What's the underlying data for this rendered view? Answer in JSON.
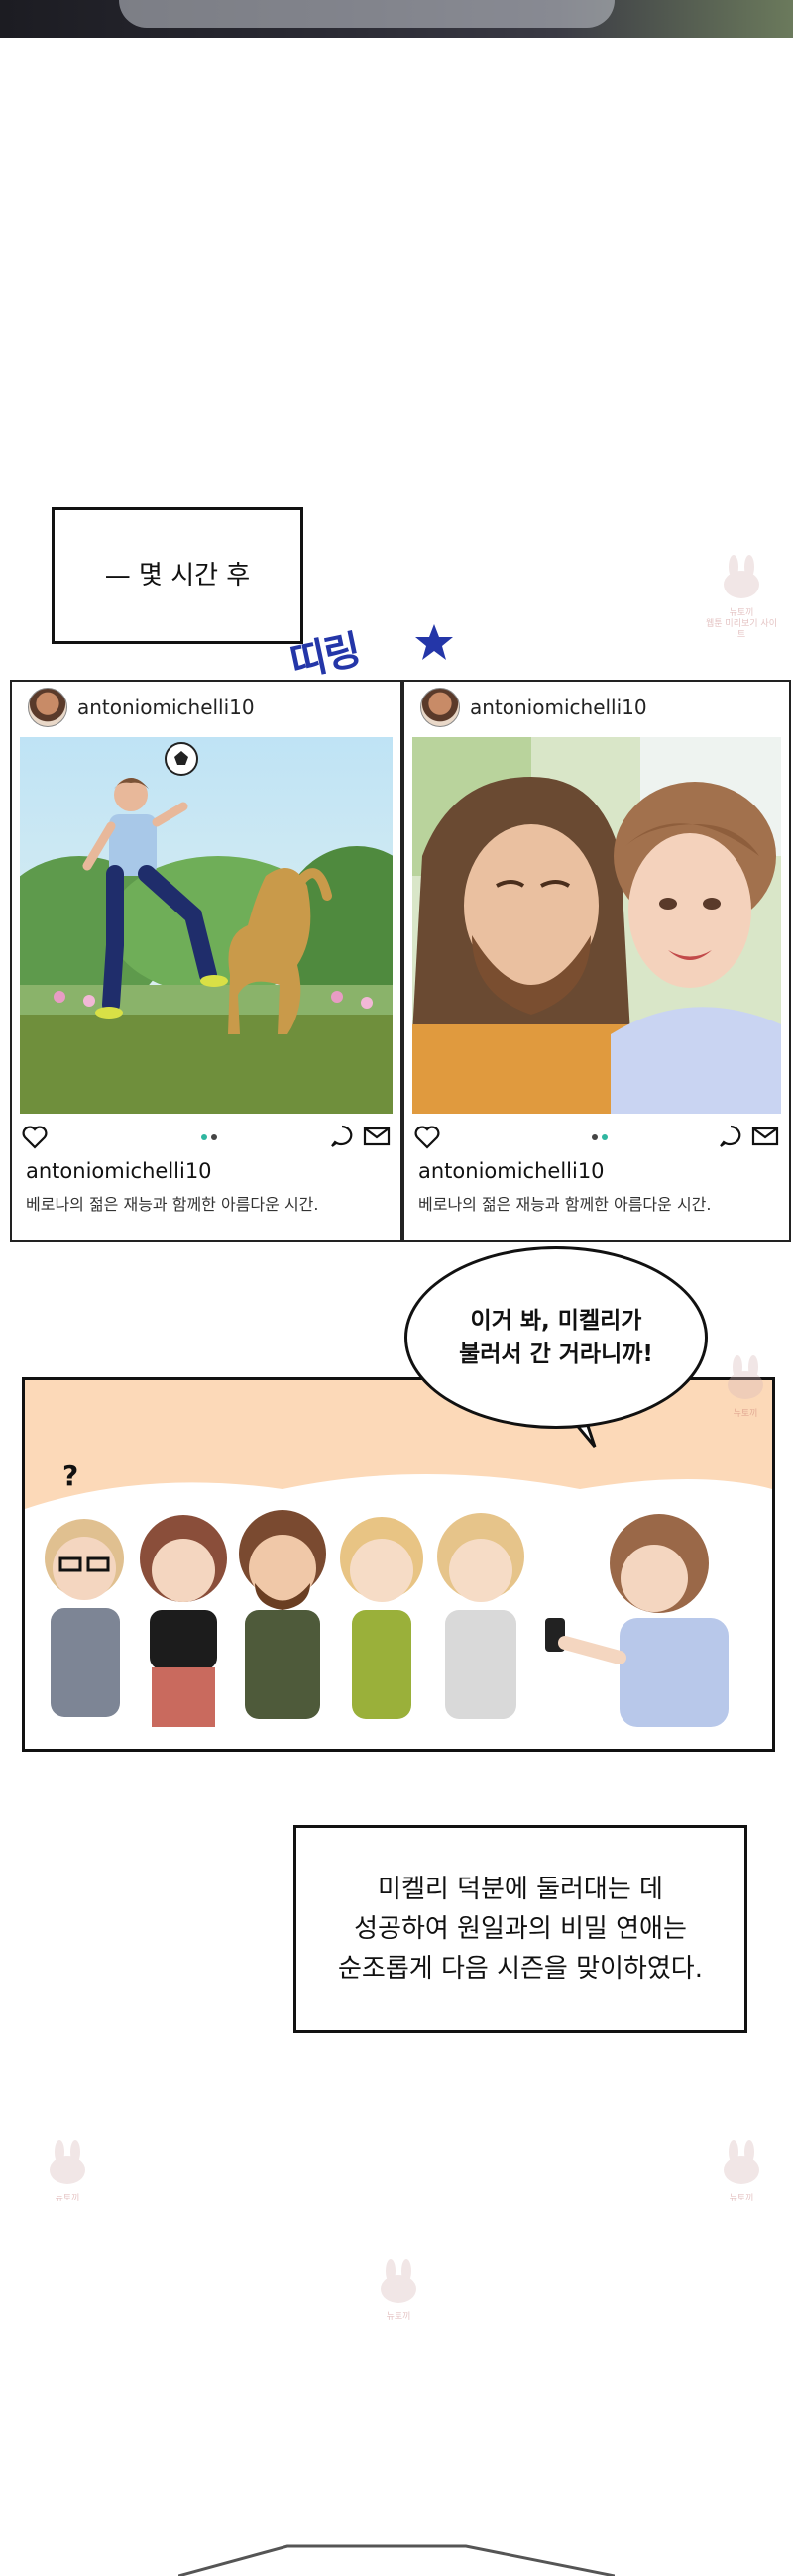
{
  "narration_1": "— 몇 시간 후",
  "sfx": "띠링",
  "posts": [
    {
      "handle": "antoniomichelli10",
      "username": "antoniomichelli10",
      "caption": "베로나의 젊은 재능과 함께한 아름다운 시간."
    },
    {
      "handle": "antoniomichelli10",
      "username": "antoniomichelli10",
      "caption": "베로나의 젊은 재능과 함께한 아름다운 시간."
    }
  ],
  "speech_1": "이거 봐, 미켈리가\n불러서 간 거라니까!",
  "question_mark": "?",
  "narration_2": "미켈리 덕분에 둘러대는 데\n성공하여 원일과의 비밀 연애는\n순조롭게 다음 시즌을 맞이하였다.",
  "watermark": {
    "line1": "뉴토끼",
    "line2": "웹툰 미리보기 사이트"
  },
  "colors": {
    "sfx": "#2436a8",
    "panel_bg": "#fcd9b8",
    "dot_active": "#2fb6a0",
    "dot_inactive": "#444444"
  }
}
